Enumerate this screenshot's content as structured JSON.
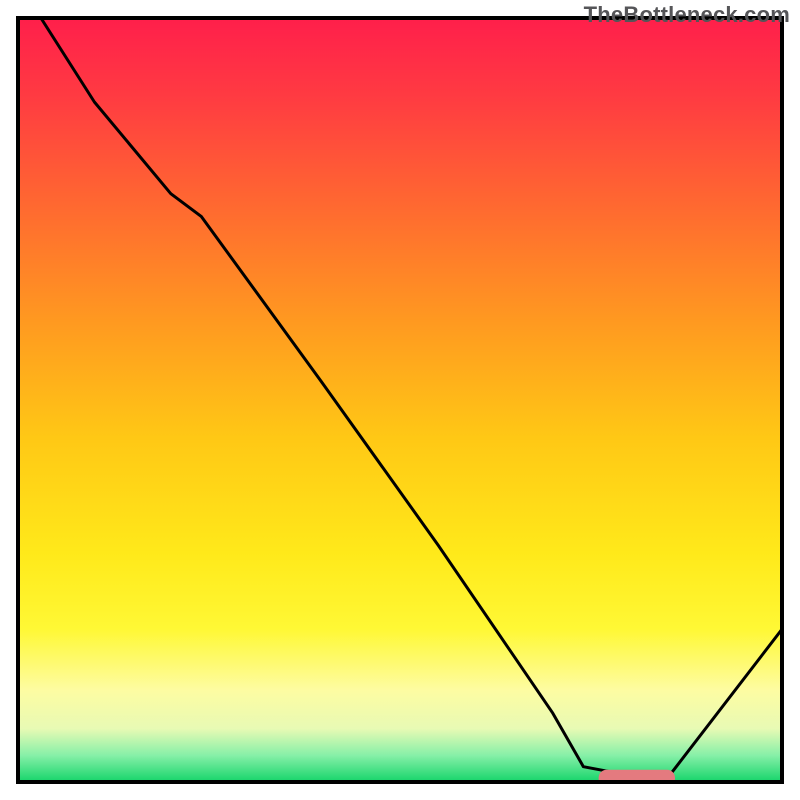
{
  "watermark": "TheBottleneck.com",
  "chart_data": {
    "type": "line",
    "title": "",
    "xlabel": "",
    "ylabel": "",
    "xlim": [
      0,
      100
    ],
    "ylim": [
      0,
      100
    ],
    "grid": false,
    "legend": false,
    "background_gradient": {
      "stops": [
        {
          "offset": 0.0,
          "color": "#ff1f4b"
        },
        {
          "offset": 0.1,
          "color": "#ff3a42"
        },
        {
          "offset": 0.25,
          "color": "#ff6a30"
        },
        {
          "offset": 0.4,
          "color": "#ff9a20"
        },
        {
          "offset": 0.55,
          "color": "#ffc815"
        },
        {
          "offset": 0.7,
          "color": "#ffe91a"
        },
        {
          "offset": 0.8,
          "color": "#fff835"
        },
        {
          "offset": 0.88,
          "color": "#fdfca2"
        },
        {
          "offset": 0.93,
          "color": "#e8fab4"
        },
        {
          "offset": 0.965,
          "color": "#87f0a8"
        },
        {
          "offset": 1.0,
          "color": "#15d46a"
        }
      ]
    },
    "series": [
      {
        "name": "bottleneck-curve",
        "stroke": "#000000",
        "stroke_width": 3,
        "x": [
          3,
          10,
          20,
          24,
          40,
          55,
          70,
          74,
          82,
          85,
          100
        ],
        "y": [
          100,
          89,
          77,
          74,
          52,
          31,
          9,
          2,
          0.5,
          0.5,
          20
        ]
      }
    ],
    "marker": {
      "name": "optimal-range",
      "color": "#e47a7f",
      "x_start": 76,
      "x_end": 86,
      "y": 0.5,
      "thickness": 2.2
    },
    "frame_color": "#000000",
    "frame_width": 4
  }
}
